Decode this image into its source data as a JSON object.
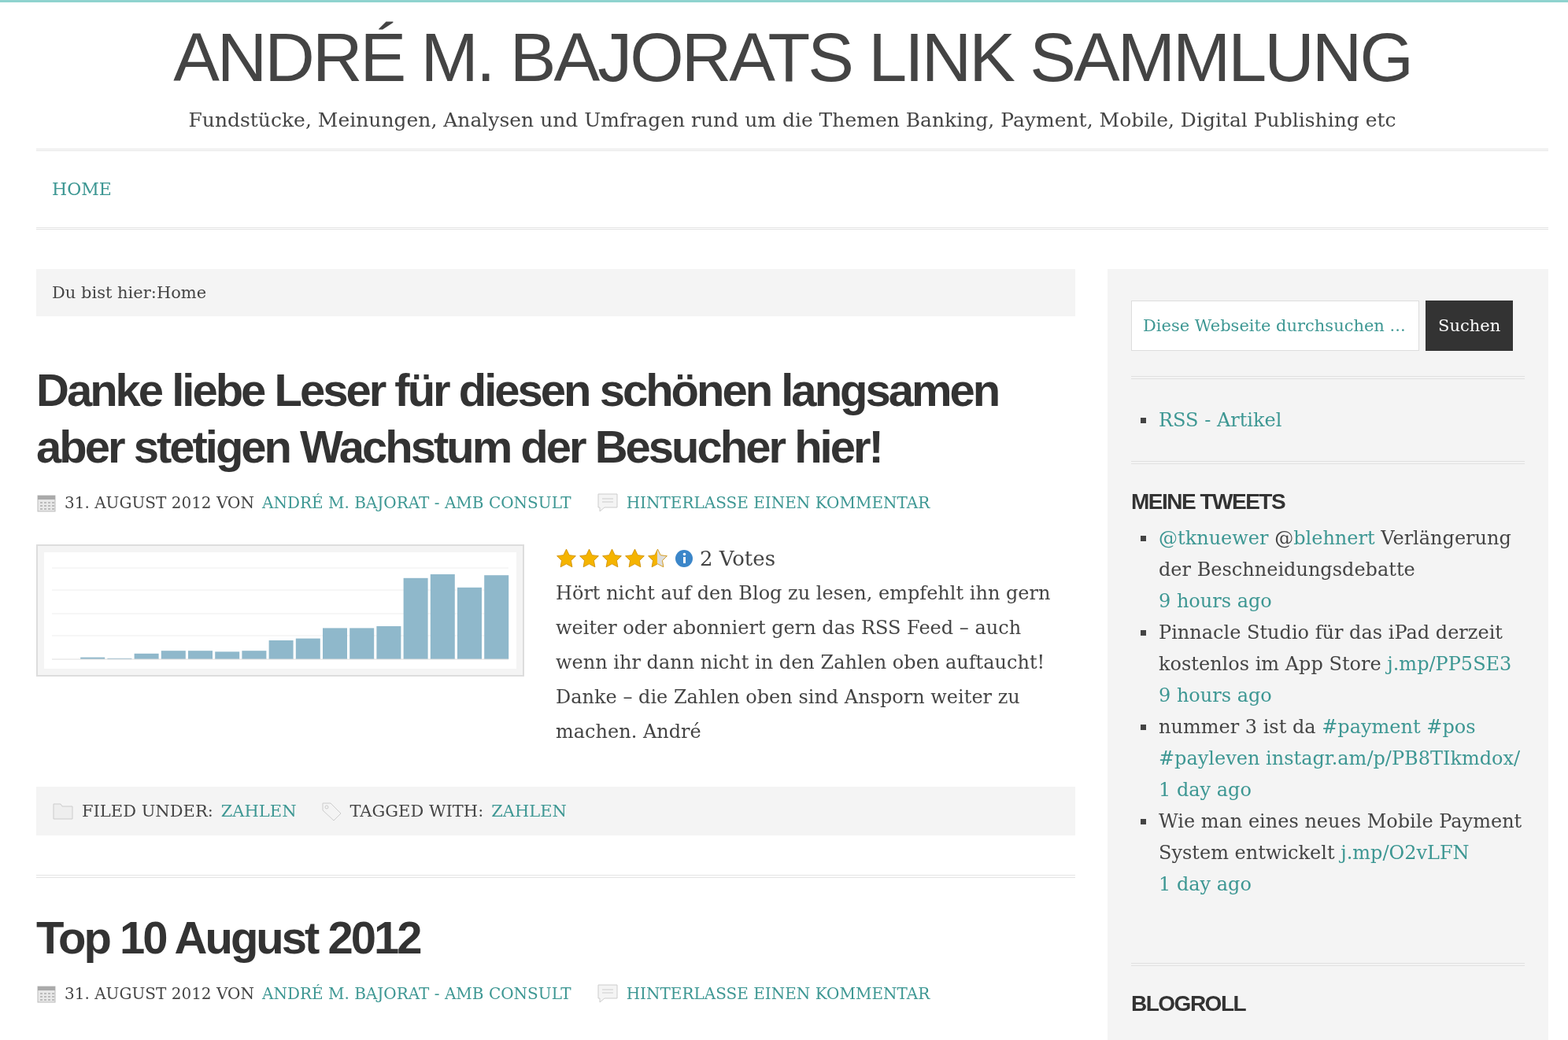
{
  "site": {
    "title": "ANDRÉ M. BAJORATS LINK SAMMLUNG",
    "tagline": "Fundstücke, Meinungen, Analysen und Umfragen rund um die Themen Banking, Payment, Mobile, Digital Publishing etc"
  },
  "nav": [
    {
      "label": "HOME",
      "selected": true
    }
  ],
  "breadcrumb": {
    "label": "Du bist hier:",
    "current": "Home"
  },
  "posts": [
    {
      "title": "Danke liebe Leser für diesen schönen langsamen aber stetigen Wachstum der Besucher hier!",
      "date": "31. AUGUST 2012",
      "by": "VON",
      "author": "ANDRÉ M. BAJORAT - AMB CONSULT",
      "comment": "HINTERLASSE EINEN KOMMENTAR",
      "image": {
        "kind": "chart"
      },
      "rating": {
        "stars": 4.5,
        "votes": "2 Votes"
      },
      "body": "Hört nicht auf den Blog zu lesen, empfehlt ihn gern weiter oder abonniert gern das RSS Feed – auch wenn ihr dann nicht in den Zahlen oben auftaucht! Danke – die Zahlen oben sind Ansporn weiter zu machen. André",
      "footer": {
        "filed_label": "FILED UNDER:",
        "filed": "ZAHLEN",
        "tagged_label": "TAGGED WITH:",
        "tagged": "ZAHLEN"
      }
    },
    {
      "title": "Top 10 August 2012",
      "date": "31. AUGUST 2012",
      "by": "VON",
      "author": "ANDRÉ M. BAJORAT - AMB CONSULT",
      "comment": "HINTERLASSE EINEN KOMMENTAR"
    }
  ],
  "sidebar": {
    "search": {
      "placeholder": "Diese Webseite durchsuchen ...",
      "button": "Suchen"
    },
    "links": [
      "RSS - Artikel"
    ],
    "tweets_title": "MEINE TWEETS",
    "tweets": [
      {
        "parts": [
          {
            "kind": "link",
            "text": "@tknuewer"
          },
          {
            "kind": "text",
            "text": "@"
          },
          {
            "kind": "link",
            "text": "blehnert"
          },
          {
            "kind": "text",
            "text": "Verlängerung der Beschneidungsdebatte"
          }
        ],
        "time": "9 hours ago"
      },
      {
        "parts": [
          {
            "kind": "text",
            "text": "Pinnacle Studio für das iPad derzeit kostenlos im App Store"
          },
          {
            "kind": "link",
            "text": "j.mp/PP5SE3"
          }
        ],
        "time": "9 hours ago"
      },
      {
        "parts": [
          {
            "kind": "text",
            "text": "nummer 3 ist da"
          },
          {
            "kind": "link",
            "text": "#payment"
          },
          {
            "kind": "link",
            "text": "#pos"
          },
          {
            "kind": "link",
            "text": "#payleven"
          },
          {
            "kind": "link",
            "text": "instagr.am/p/PB8TIkmdox/"
          }
        ],
        "time": "1 day ago"
      },
      {
        "parts": [
          {
            "kind": "text",
            "text": "Wie man eines neues Mobile Payment System entwickelt"
          },
          {
            "kind": "link",
            "text": "j.mp/O2vLFN"
          }
        ],
        "time": "1 day ago"
      }
    ],
    "next_title": "BLOGROLL"
  }
}
